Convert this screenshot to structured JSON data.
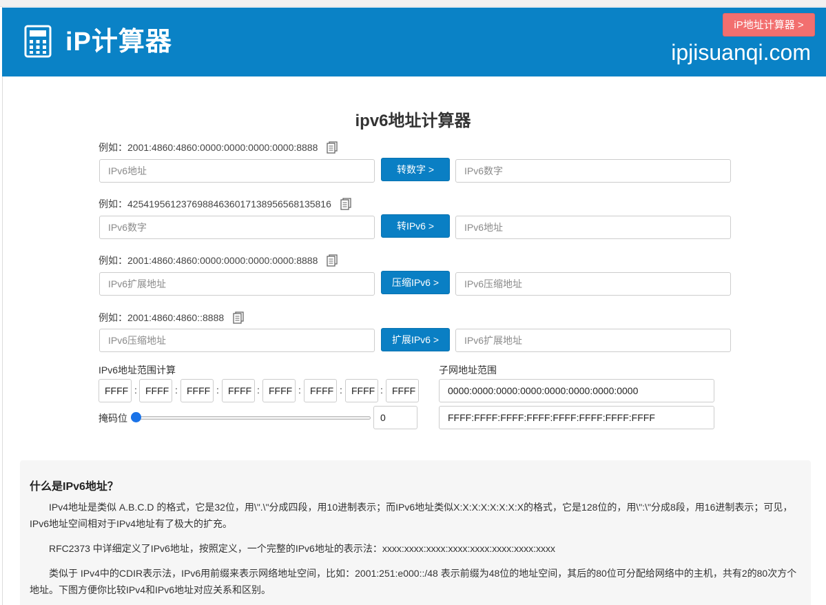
{
  "header": {
    "logo_text": "iP计算器",
    "calc_button": "iP地址计算器 >",
    "domain": "ipjisuanqi.com"
  },
  "page_title": "ipv6地址计算器",
  "rows": [
    {
      "example": "例如：2001:4860:4860:0000:0000:0000:0000:8888",
      "left_placeholder": "IPv6地址",
      "button": "转数字 >",
      "right_placeholder": "IPv6数字"
    },
    {
      "example": "例如：42541956123769884636017138956568135816",
      "left_placeholder": "IPv6数字",
      "button": "转IPv6 >",
      "right_placeholder": "IPv6地址"
    },
    {
      "example": "例如：2001:4860:4860:0000:0000:0000:0000:8888",
      "left_placeholder": "IPv6扩展地址",
      "button": "压缩IPv6 >",
      "right_placeholder": "IPv6压缩地址"
    },
    {
      "example": "例如：2001:4860:4860::8888",
      "left_placeholder": "IPv6压缩地址",
      "button": "扩展IPv6 >",
      "right_placeholder": "IPv6扩展地址"
    }
  ],
  "range_calc": {
    "label": "IPv6地址范围计算",
    "segments": [
      "FFFF",
      "FFFF",
      "FFFF",
      "FFFF",
      "FFFF",
      "FFFF",
      "FFFF",
      "FFFF"
    ],
    "separator": ":",
    "mask_label": "掩码位",
    "mask_value": "0",
    "mask_min": 0,
    "mask_max": 128
  },
  "subnet": {
    "label": "子网地址范围",
    "start": "0000:0000:0000:0000:0000:0000:0000:0000",
    "end": "FFFF:FFFF:FFFF:FFFF:FFFF:FFFF:FFFF:FFFF"
  },
  "info": {
    "heading": "什么是IPv6地址？",
    "p1": "IPv4地址是类似 A.B.C.D 的格式，它是32位，用\\\".\\\"分成四段，用10进制表示；而IPv6地址类似X:X:X:X:X:X:X:X的格式，它是128位的，用\\\":\\\"分成8段，用16进制表示；可见，IPv6地址空间相对于IPv4地址有了极大的扩充。",
    "p2": "RFC2373 中详细定义了IPv6地址，按照定义，一个完整的IPv6地址的表示法：xxxx:xxxx:xxxx:xxxx:xxxx:xxxx:xxxx:xxxx",
    "p3": "类似于 IPv4中的CDIR表示法，IPv6用前缀来表示网络地址空间，比如：2001:251:e000::/48 表示前缀为48位的地址空间，其后的80位可分配给网络中的主机，共有2的80次方个地址。下图方便你比较IPv4和IPv6地址对应关系和区别。"
  },
  "colors": {
    "header_bg": "#0a82c6",
    "primary_button": "#0a7fc4",
    "calc_button": "#f26f6f"
  }
}
